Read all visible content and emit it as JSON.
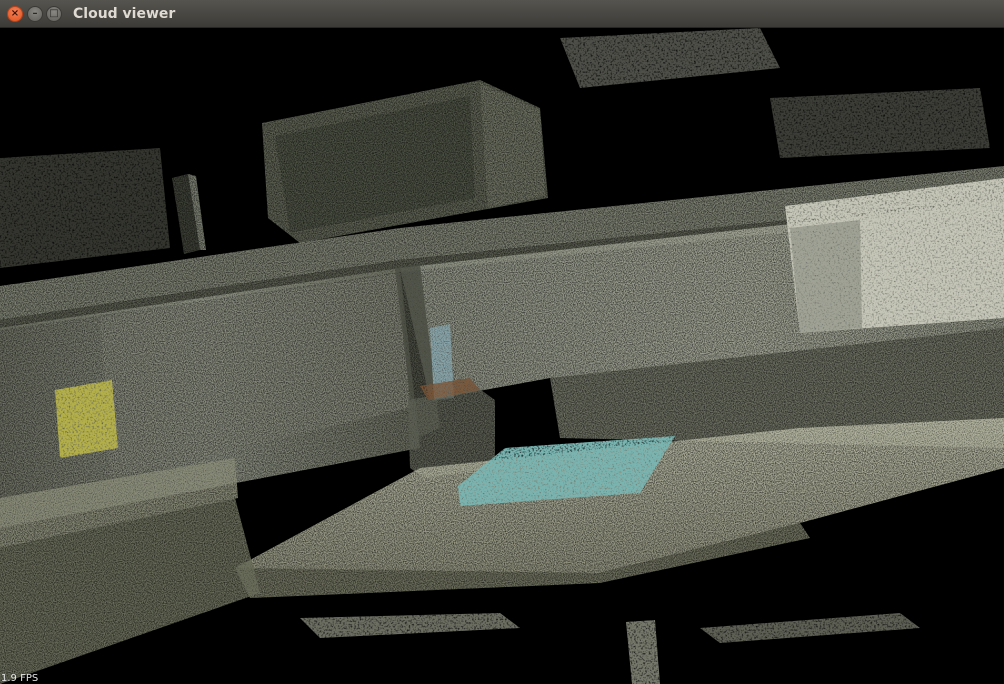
{
  "window": {
    "title": "Cloud viewer",
    "controls": {
      "close_glyph": "×",
      "minimize_glyph": "–",
      "maximize_glyph": "□"
    }
  },
  "viewer": {
    "fps_text": "1.9 FPS",
    "background_color": "#000000"
  }
}
